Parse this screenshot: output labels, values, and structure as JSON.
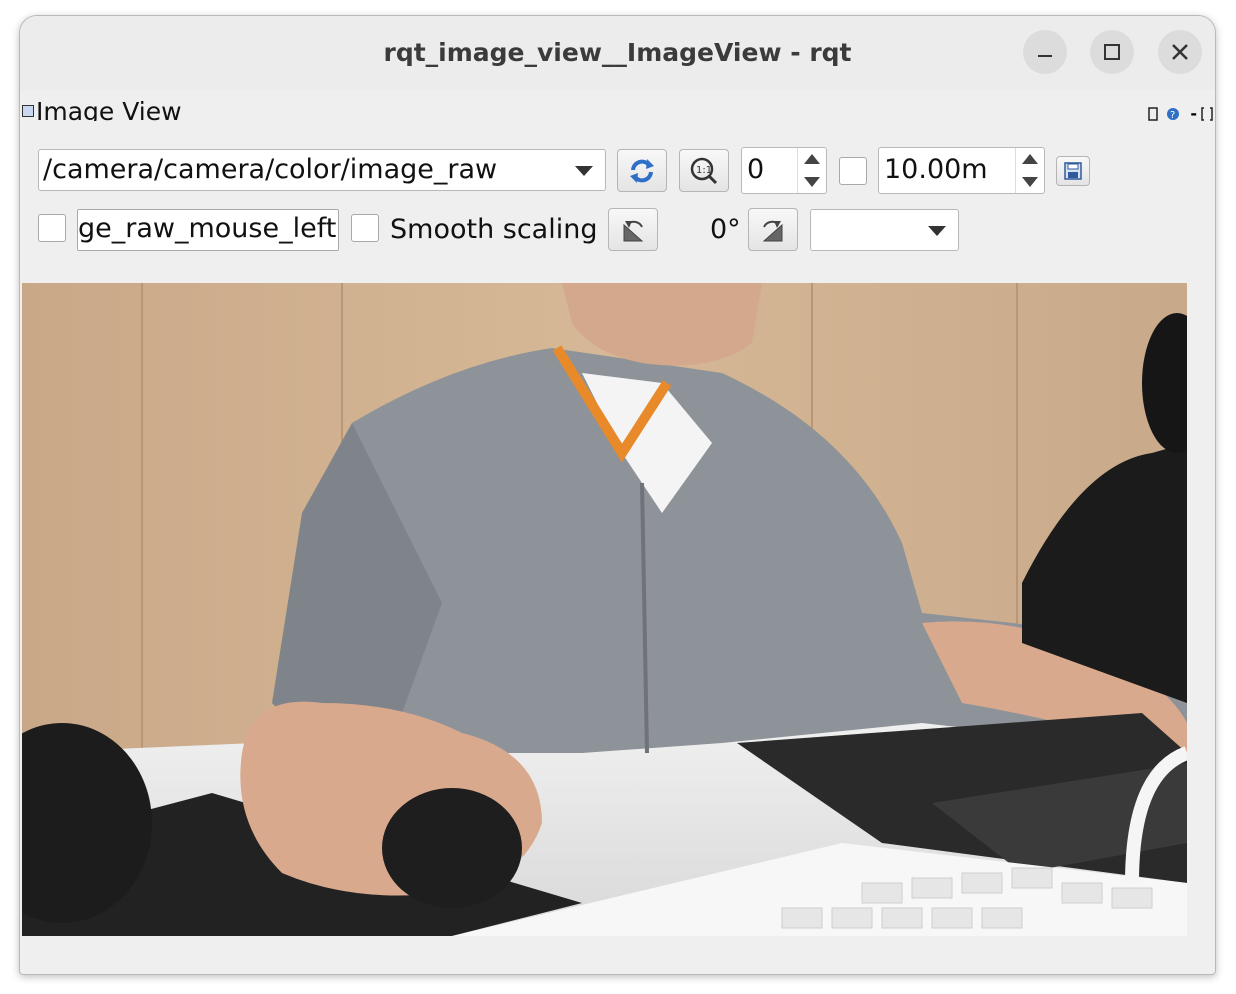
{
  "window": {
    "title": "rqt_image_view__ImageView - rqt",
    "controls": [
      "minimize-icon",
      "maximize-icon",
      "close-icon"
    ]
  },
  "dock": {
    "title": "Image View",
    "right_icons": [
      "dock-icon",
      "help-icon",
      "minus-icon",
      "float-icon"
    ],
    "right_text": "-"
  },
  "toolbar": {
    "topic_value": "/camera/camera/color/image_raw",
    "refresh_icon": "refresh-icon",
    "zoom_icon": "zoom-1to1-icon",
    "frame_value": "0",
    "max_range_value": "10.00m",
    "save_icon": "save-icon",
    "mouse_topic_value": "ge_raw_mouse_left",
    "smooth_scaling_label": "Smooth scaling",
    "rotation_value": "0°",
    "rotate_left_icon": "rotate-left-icon",
    "rotate_right_icon": "rotate-right-icon",
    "color_scheme_value": ""
  },
  "colors": {
    "window_bg": "#efefef",
    "titlebar_bg": "#ececec",
    "accent_blue": "#2f6fc7"
  },
  "image": {
    "description_icon": "camera-feed-image"
  }
}
